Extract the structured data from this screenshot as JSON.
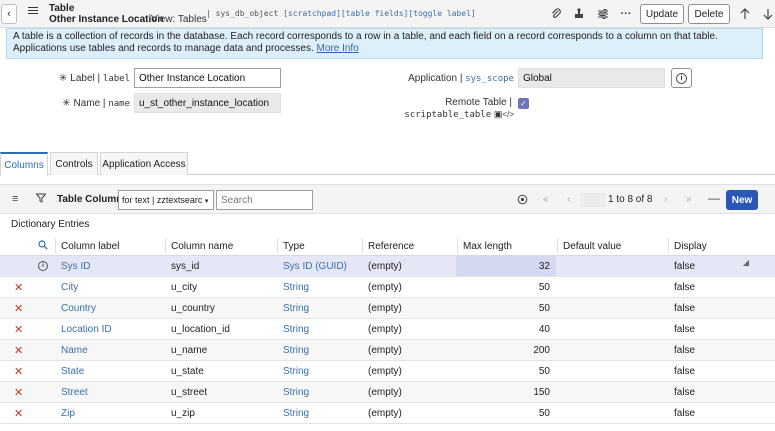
{
  "header": {
    "record_type": "Table",
    "record_name": "Other Instance Location",
    "view": "View: Tables",
    "sys_tag_prefix": "sys_db_object",
    "sys_tag_links": "[scratchpad][table fields][toggle label]",
    "update_label": "Update",
    "delete_label": "Delete",
    "icons": [
      "paperclip-icon",
      "stamp-icon",
      "sliders-icon",
      "more-icon",
      "arrow-up-icon",
      "arrow-down-icon"
    ]
  },
  "banner": {
    "text": "A table is a collection of records in the database. Each record corresponds to a row in a table, and each field on a record corresponds to a column on that table. Applications use tables and records to manage data and processes. ",
    "more_link": "More Info"
  },
  "form": {
    "label_field": {
      "label": "Label",
      "mono": "label",
      "value": "Other Instance Location"
    },
    "name_field": {
      "label": "Name",
      "mono": "name",
      "value": "u_st_other_instance_location"
    },
    "application_field": {
      "label": "Application",
      "mono": "sys_scope",
      "value": "Global"
    },
    "remote_table_field": {
      "label": "Remote Table",
      "mono": "scriptable_table",
      "checked": true
    }
  },
  "tabs": [
    {
      "label": "Columns",
      "active": true
    },
    {
      "label": "Controls",
      "active": false
    },
    {
      "label": "Application Access",
      "active": false
    }
  ],
  "list": {
    "title": "Table Columns",
    "search_field": "for text | zztextsearc",
    "search_placeholder": "Search",
    "page_info": "1  to 8 of 8",
    "new_label": "New",
    "section_title": "Dictionary Entries",
    "columns": [
      "Column label",
      "Column name",
      "Type",
      "Reference",
      "Max length",
      "Default value",
      "Display"
    ],
    "rows": [
      {
        "label": "Sys ID",
        "name": "sys_id",
        "type": "Sys ID (GUID)",
        "reference": "(empty)",
        "max_length": "32",
        "default": "",
        "display": "false",
        "system": true
      },
      {
        "label": "City",
        "name": "u_city",
        "type": "String",
        "reference": "(empty)",
        "max_length": "50",
        "default": "",
        "display": "false",
        "system": false
      },
      {
        "label": "Country",
        "name": "u_country",
        "type": "String",
        "reference": "(empty)",
        "max_length": "50",
        "default": "",
        "display": "false",
        "system": false
      },
      {
        "label": "Location ID",
        "name": "u_location_id",
        "type": "String",
        "reference": "(empty)",
        "max_length": "40",
        "default": "",
        "display": "false",
        "system": false
      },
      {
        "label": "Name",
        "name": "u_name",
        "type": "String",
        "reference": "(empty)",
        "max_length": "200",
        "default": "",
        "display": "false",
        "system": false
      },
      {
        "label": "State",
        "name": "u_state",
        "type": "String",
        "reference": "(empty)",
        "max_length": "50",
        "default": "",
        "display": "false",
        "system": false
      },
      {
        "label": "Street",
        "name": "u_street",
        "type": "String",
        "reference": "(empty)",
        "max_length": "150",
        "default": "",
        "display": "false",
        "system": false
      },
      {
        "label": "Zip",
        "name": "u_zip",
        "type": "String",
        "reference": "(empty)",
        "max_length": "50",
        "default": "",
        "display": "false",
        "system": false
      }
    ]
  },
  "colors": {
    "accent": "#2b57b4",
    "link": "#3c6fa8",
    "banner": "#dceffb",
    "highlight_row": "#e6e7f6"
  }
}
